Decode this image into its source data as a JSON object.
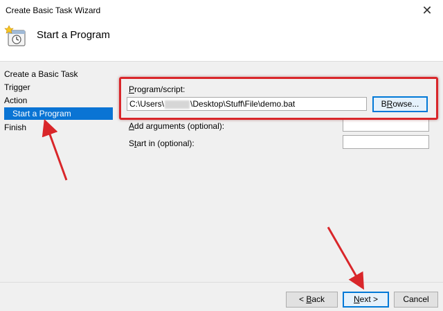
{
  "window": {
    "title": "Create Basic Task Wizard",
    "close_glyph": "✕"
  },
  "header": {
    "title": "Start a Program",
    "icon": "task-clock-icon"
  },
  "sidebar": {
    "items": [
      {
        "label": "Create a Basic Task",
        "active": false
      },
      {
        "label": "Trigger",
        "active": false
      },
      {
        "label": "Action",
        "active": false
      },
      {
        "label": "Start a Program",
        "active": true
      },
      {
        "label": "Finish",
        "active": false
      }
    ]
  },
  "form": {
    "program_label_pre": "",
    "program_label_u": "P",
    "program_label_post": "rogram/script:",
    "program_value_pre": "C:\\Users\\",
    "program_value_post": "\\Desktop\\Stuff\\File\\demo.bat",
    "browse_u": "R",
    "browse_pre": "B",
    "browse_post": "owse...",
    "args_label_u": "A",
    "args_label_post": "dd arguments (optional):",
    "args_value": "",
    "startin_label_pre": "S",
    "startin_label_u": "t",
    "startin_label_post": "art in (optional):",
    "startin_value": ""
  },
  "footer": {
    "back_pre": "< ",
    "back_u": "B",
    "back_post": "ack",
    "next_u": "N",
    "next_post": "ext >",
    "cancel_label": "Cancel"
  },
  "annotations": {
    "highlight_color": "#d9262a",
    "arrow_color": "#d9262a"
  }
}
